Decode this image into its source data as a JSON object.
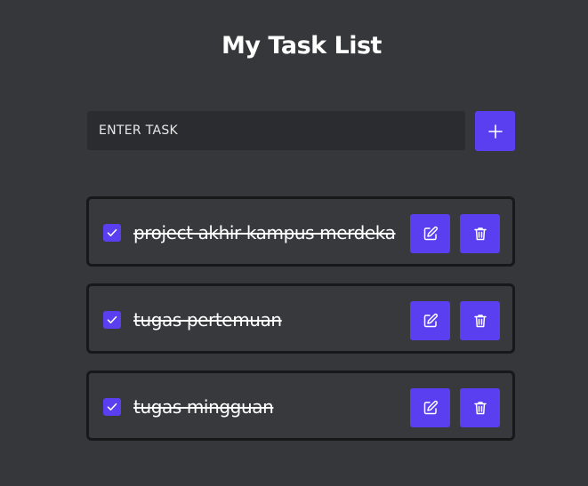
{
  "app": {
    "title": "My Task List"
  },
  "input": {
    "placeholder": "ENTER TASK",
    "value": ""
  },
  "add_button": {
    "icon": "plus-icon"
  },
  "tasks": [
    {
      "text": "project akhir kampus merdeka",
      "completed": true
    },
    {
      "text": "tugas pertemuan",
      "completed": true
    },
    {
      "text": "tugas mingguan",
      "completed": true
    }
  ],
  "task_actions": {
    "edit_icon": "edit-icon",
    "delete_icon": "trash-icon"
  },
  "colors": {
    "background": "#35373b",
    "accent": "#5a3ff0",
    "input_bg": "#2a2c2f",
    "item_border": "#17181a"
  }
}
